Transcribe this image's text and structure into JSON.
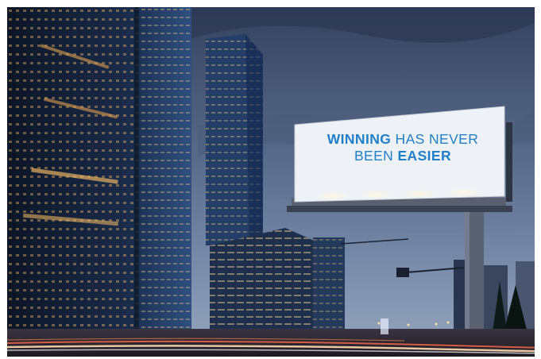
{
  "billboard": {
    "line1_bold": "WINNING",
    "line1_rest": "HAS NEVER",
    "line2_rest": "BEEN",
    "line2_bold": "EASIER",
    "text_color": "#1f7fc7",
    "panel_color": "#eef2f6"
  },
  "scene": {
    "sky_top": "#3a4a66",
    "sky_bottom": "#8a9bb8",
    "tower_color": "#0f1c33",
    "window_light": "#f0c070"
  }
}
